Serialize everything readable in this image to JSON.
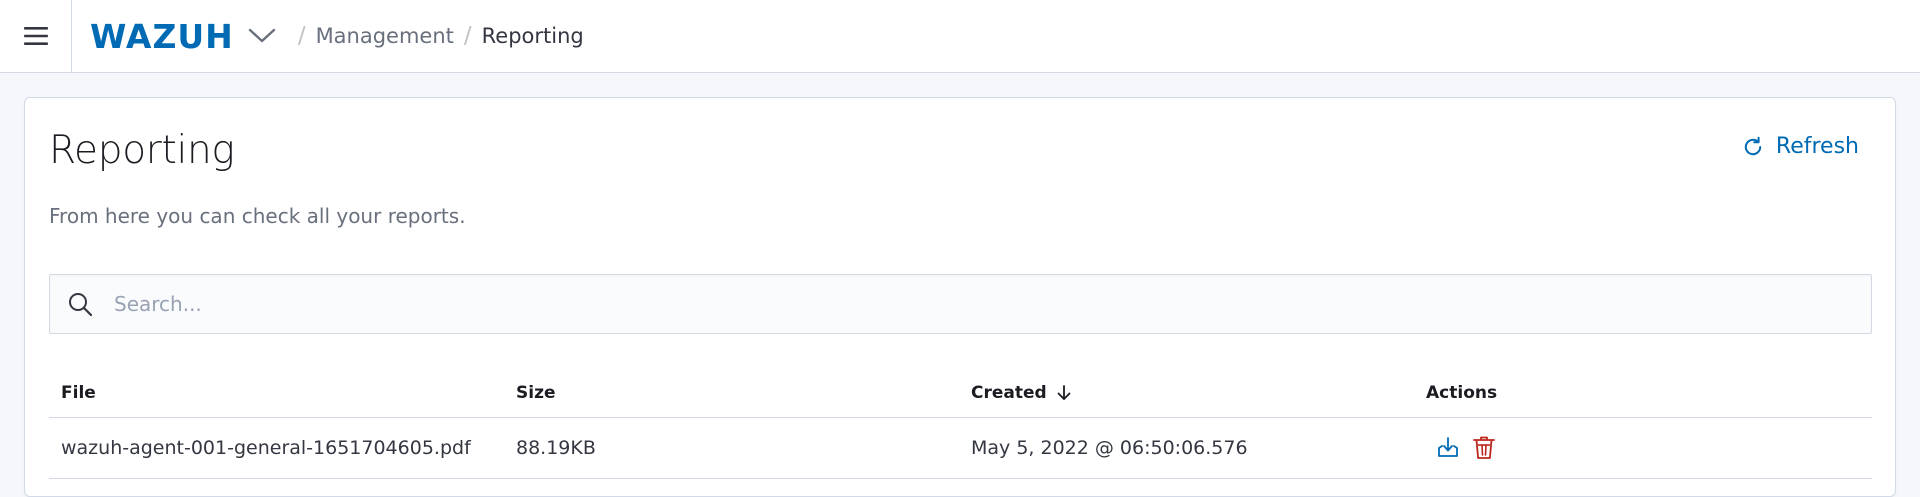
{
  "header": {
    "logo_text": "WAZUH",
    "breadcrumbs": [
      {
        "label": "Management"
      },
      {
        "label": "Reporting"
      }
    ]
  },
  "panel": {
    "title": "Reporting",
    "description": "From here you can check all your reports.",
    "refresh_label": "Refresh"
  },
  "search": {
    "placeholder": "Search...",
    "value": ""
  },
  "table": {
    "columns": {
      "file": "File",
      "size": "Size",
      "created": "Created",
      "actions": "Actions"
    },
    "sort": {
      "column": "created",
      "direction": "descending"
    },
    "rows": [
      {
        "file": "wazuh-agent-001-general-1651704605.pdf",
        "size": "88.19KB",
        "created": "May 5, 2022 @ 06:50:06.576",
        "actions": [
          "download-icon",
          "trash-icon"
        ]
      }
    ]
  },
  "colors": {
    "brand": "#006bb4",
    "danger": "#bd271e",
    "border": "#d3dae6",
    "text": "#343741",
    "muted": "#69707d"
  }
}
